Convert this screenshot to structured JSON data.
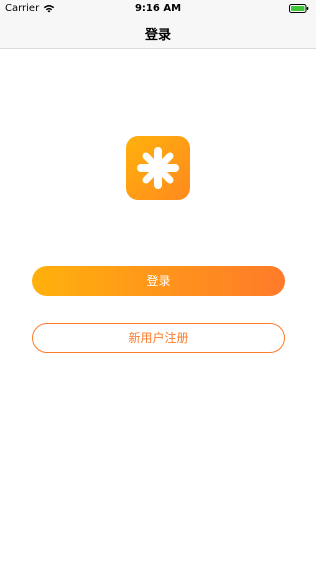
{
  "status_bar": {
    "carrier": "Carrier",
    "time": "9:16 AM",
    "wifi_icon": "wifi-icon",
    "battery_icon": "battery-icon"
  },
  "nav": {
    "title": "登录"
  },
  "logo": {
    "icon": "app-logo-icon",
    "colors": [
      "#ffb10c",
      "#ff8a1e"
    ]
  },
  "actions": {
    "login_label": "登录",
    "register_label": "新用户注册"
  },
  "colors": {
    "accent_start": "#ffb10c",
    "accent_end": "#ff7a2a",
    "navbar_bg": "#f7f7f7"
  }
}
